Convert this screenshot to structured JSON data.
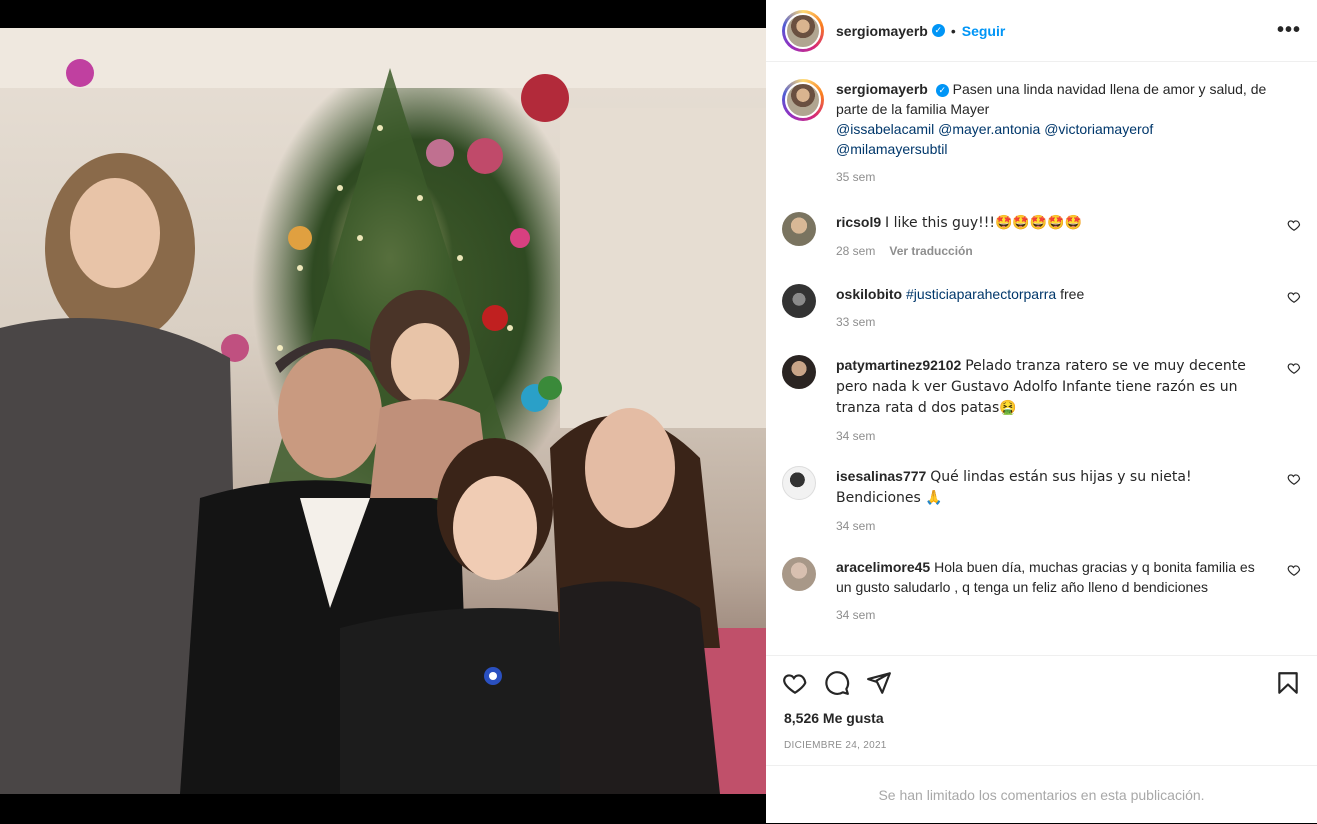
{
  "post": {
    "username": "sergiomayerb",
    "follow_label": "Seguir",
    "more_label": "•••",
    "caption_before": "Pasen una linda navidad llena de amor y salud, de parte de la familia Mayer",
    "mentions": [
      "@issabelacamil",
      "@mayer.antonia",
      "@victoriamayerof",
      "@milamayersubtil"
    ],
    "caption_time": "35 sem"
  },
  "comments": [
    {
      "username": "ricsol9",
      "text": "I like this guy!!!🤩🤩🤩🤩🤩",
      "time": "28 sem",
      "translate": "Ver traducción"
    },
    {
      "username": "oskilobito",
      "hashtag": "#justiciaparahectorparra",
      "text": " free",
      "time": "33 sem"
    },
    {
      "username": "patymartinez92102",
      "text": "Pelado tranza ratero se ve muy decente pero nada k ver Gustavo Adolfo Infante tiene razón es un tranza rata d dos patas🤮",
      "time": "34 sem"
    },
    {
      "username": "isesalinas777",
      "text": "Qué lindas están sus hijas y su nieta! Bendiciones 🙏",
      "time": "34 sem"
    },
    {
      "username": "aracelimore45",
      "text": "Hola buen día, muchas gracias y q bonita familia es un gusto saludarlo , q tenga un feliz año lleno d bendiciones",
      "time": "34 sem"
    }
  ],
  "footer": {
    "likes": "8,526 Me gusta",
    "date": "DICIEMBRE 24, 2021",
    "limited": "Se han limitado los comentarios en esta publicación."
  },
  "colors": {
    "accent": "#0095f6",
    "mention": "#00376b",
    "muted": "#8e8e8e"
  }
}
